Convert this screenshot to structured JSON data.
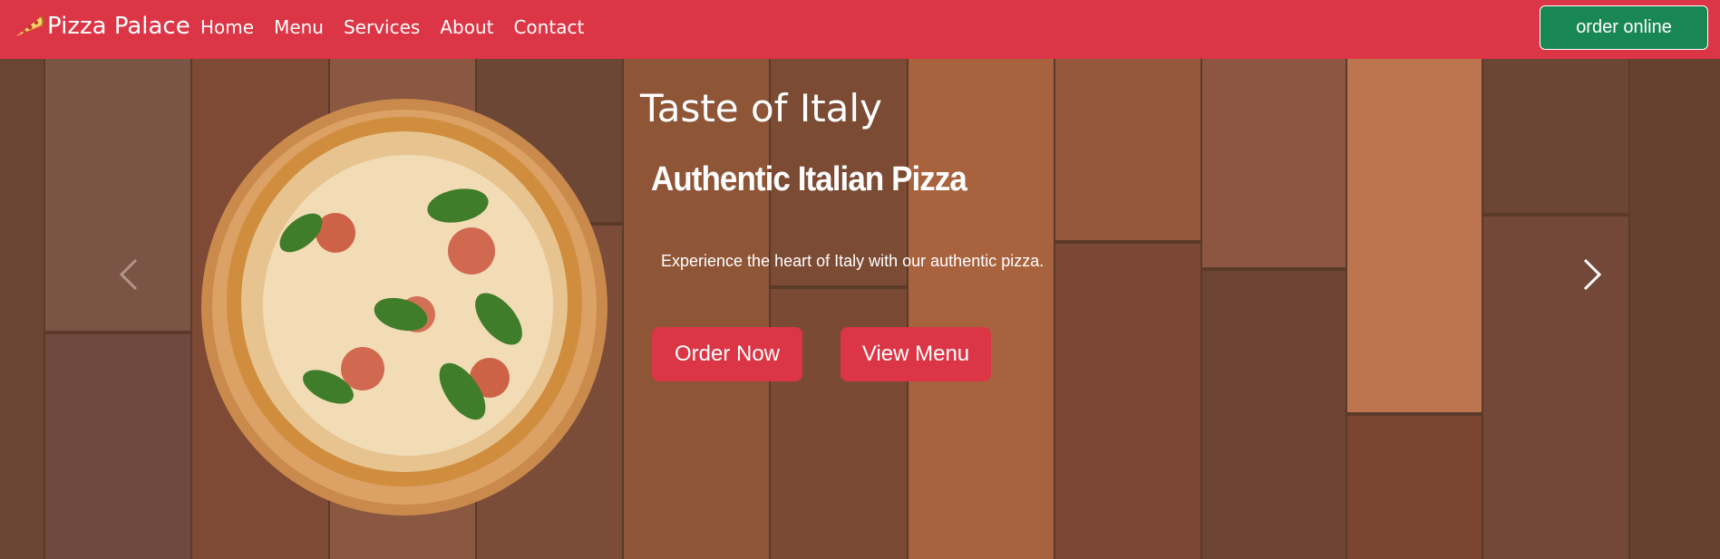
{
  "navbar": {
    "brand": "Pizza Palace",
    "brand_icon": "pizza-slice-icon",
    "links": [
      "Home",
      "Menu",
      "Services",
      "About",
      "Contact"
    ],
    "order_button": "order online",
    "bg_color": "#dc3545",
    "order_color": "#198754"
  },
  "hero": {
    "tagline": "Taste of Italy",
    "headline": "Authentic Italian Pizza",
    "subtext": "Experience the heart of Italy with our authentic pizza.",
    "buttons": [
      "Order Now",
      "View Menu"
    ],
    "prev_icon": "chevron-left-icon",
    "next_icon": "chevron-right-icon",
    "button_color": "#dc3545"
  }
}
